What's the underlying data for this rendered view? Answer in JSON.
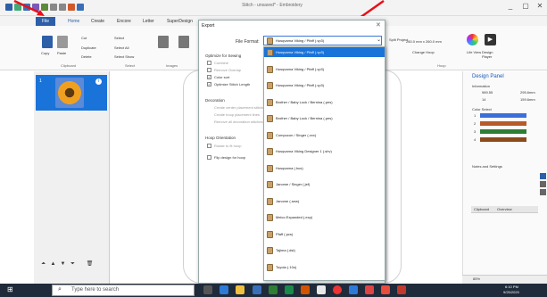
{
  "titlebar": {
    "title": "Stitch - unsaved* - Embroidery",
    "controls": [
      "_",
      "▢",
      "✕"
    ]
  },
  "tabs": [
    {
      "label": "File"
    },
    {
      "label": "Home"
    },
    {
      "label": "Create"
    },
    {
      "label": "Encore"
    },
    {
      "label": "Letter"
    },
    {
      "label": "SuperDesign"
    }
  ],
  "ribbon": {
    "copy": "Copy",
    "paste": "Paste",
    "cut": "Cut",
    "duplicate": "Duplicate",
    "delete": "Delete",
    "select": "Select",
    "select_all": "Select All",
    "select_show": "Select Show",
    "clipboard": "Clipboard",
    "group_select": "Select",
    "images": "Images",
    "hoop_text": "260.0 mm x 260.0 mm",
    "change_hoop": "Change Hoop",
    "group_hoop": "Hoop",
    "split_project": "Split Project",
    "design_player": "Design Player",
    "life_view": "Life View"
  },
  "left": {
    "thumb_num": "1",
    "thumb_badge": "i"
  },
  "design_panel": {
    "title": "Design Panel",
    "information": "Information",
    "w": "989.55",
    "h": "295.6mm",
    "stitches": "14",
    "size": "159.6mm",
    "color_select": "Color Select",
    "colors": [
      "#3b6fd8",
      "#b85a2a",
      "#2e7d34",
      "#8b4a1c"
    ],
    "color_nums": [
      "1",
      "2",
      "3",
      "4"
    ],
    "notes": "Notes and Settings",
    "clipboard": "Clipboard",
    "overview": "Overview"
  },
  "dialog": {
    "title": "Export",
    "close": "✕",
    "file_format_label": "File Format:",
    "file_format_value": "Husqvarna Viking / Pfaff (.vp3)",
    "optimize": "Optimize for Sewing",
    "opt1": "Combine",
    "opt2": "Remove Overlap",
    "opt3": "Color sort",
    "opt4": "Optimize Stitch Length",
    "decoration": "Decoration",
    "dec1": "Create center placement stitches",
    "dec2": "Create hoop placement lines",
    "dec3": "Remove all decoration stitches",
    "hoop_orientation": "Hoop Orientation",
    "ho1": "Rotate to fit hoop",
    "ho2": "Flip design for hoop",
    "stitch_options": "Stitching Options",
    "ok": "OK",
    "cancel": "Cancel",
    "help": "Help"
  },
  "dropdown": [
    "Husqvarna Viking / Pfaff (.vp3)",
    "Husqvarna Viking / Pfaff (.vp3)",
    "Husqvarna Viking / Pfaff (.vp3)",
    "Brother / Baby Lock / Bernina (.pes)",
    "Brother / Baby Lock / Bernina (.pes)",
    "Compucon / Singer (.xxx)",
    "Husqvarna Viking Designer 1 (.shv)",
    "Husqvarna (.hus)",
    "Janome / Singer (.jef)",
    "Janome (.sew)",
    "Melco Expanded (.exp)",
    "Pfaff (.pcs)",
    "Tajima (.dst)",
    "Toyota (.10o)"
  ],
  "taskbar": {
    "search_placeholder": "Type here to search",
    "time": "6:10 PM",
    "date": "9/25/2020"
  },
  "status": {
    "zoom": "85%"
  }
}
